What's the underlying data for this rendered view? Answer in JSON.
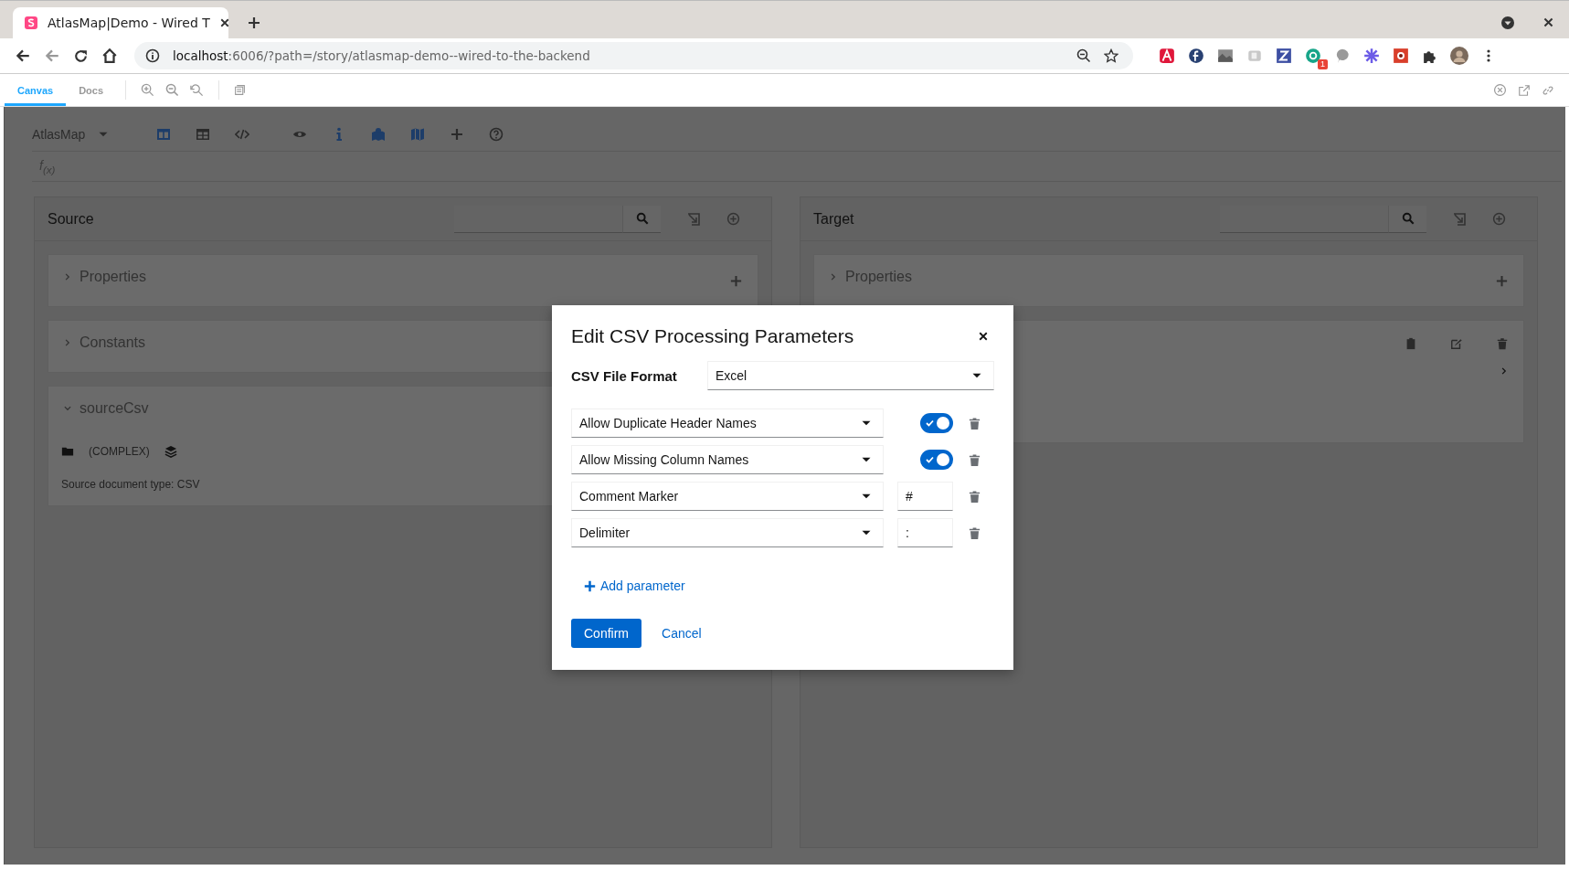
{
  "browser": {
    "tab_title": "AtlasMap|Demo - Wired T",
    "url_host": "localhost",
    "url_path": ":6006/?path=/story/atlasmap-demo--wired-to-the-backend",
    "extension_badge": "1"
  },
  "storybook": {
    "tabs": [
      {
        "label": "Canvas",
        "selected": true
      },
      {
        "label": "Docs",
        "selected": false
      }
    ]
  },
  "app": {
    "brand": "AtlasMap",
    "expression": "f$_{(x)}$"
  },
  "source": {
    "title": "Source",
    "sections": [
      {
        "label": "Properties",
        "expanded": false
      },
      {
        "label": "Constants",
        "expanded": false
      },
      {
        "label": "sourceCsv",
        "expanded": true,
        "type_label": "(COMPLEX)",
        "note": "Source document type: CSV"
      }
    ]
  },
  "target": {
    "title": "Target",
    "sections": [
      {
        "label": "Properties",
        "expanded": false
      }
    ]
  },
  "modal": {
    "title": "Edit CSV Processing Parameters",
    "format_label": "CSV File Format",
    "format_value": "Excel",
    "parameters": [
      {
        "name": "Allow Duplicate Header Names",
        "kind": "toggle",
        "on": true
      },
      {
        "name": "Allow Missing Column Names",
        "kind": "toggle",
        "on": true
      },
      {
        "name": "Comment Marker",
        "kind": "text",
        "value": "#"
      },
      {
        "name": "Delimiter",
        "kind": "text",
        "value": ":"
      }
    ],
    "add_label": "Add parameter",
    "confirm": "Confirm",
    "cancel": "Cancel"
  }
}
